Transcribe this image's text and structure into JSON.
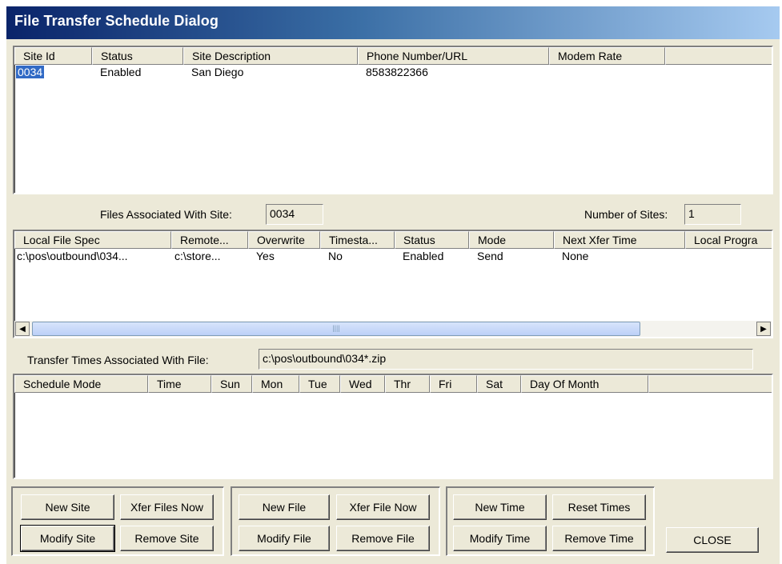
{
  "window": {
    "title": "File Transfer Schedule Dialog"
  },
  "sites": {
    "columns": [
      "Site Id",
      "Status",
      "Site Description",
      "Phone Number/URL",
      "Modem Rate"
    ],
    "rows": [
      {
        "site_id": "0034",
        "status": "Enabled",
        "description": "San Diego",
        "phone": "8583822366",
        "modem_rate": ""
      }
    ]
  },
  "files_assoc": {
    "label": "Files Associated With Site:",
    "value": "0034"
  },
  "num_sites": {
    "label": "Number of Sites:",
    "value": "1"
  },
  "files": {
    "columns": [
      "Local File Spec",
      "Remote...",
      "Overwrite",
      "Timesta...",
      "Status",
      "Mode",
      "Next Xfer Time",
      "Local Progra"
    ],
    "rows": [
      {
        "local": "c:\\pos\\outbound\\034...",
        "remote": "c:\\store...",
        "overwrite": "Yes",
        "timestamp": "No",
        "status": "Enabled",
        "mode": "Send",
        "next": "None",
        "prog": ""
      }
    ],
    "scroll_thumb_icon": "grip-icon"
  },
  "times_assoc": {
    "label": "Transfer Times Associated With File:",
    "value": "c:\\pos\\outbound\\034*.zip"
  },
  "times": {
    "columns": [
      "Schedule Mode",
      "Time",
      "Sun",
      "Mon",
      "Tue",
      "Wed",
      "Thr",
      "Fri",
      "Sat",
      "Day Of Month"
    ],
    "rows": []
  },
  "buttons": {
    "new_site": "New Site",
    "xfer_files_now": "Xfer Files Now",
    "modify_site": "Modify Site",
    "remove_site": "Remove Site",
    "new_file": "New File",
    "xfer_file_now": "Xfer File Now",
    "modify_file": "Modify File",
    "remove_file": "Remove File",
    "new_time": "New Time",
    "reset_times": "Reset Times",
    "modify_time": "Modify Time",
    "remove_time": "Remove Time",
    "close": "CLOSE"
  },
  "colors": {
    "title_start": "#0a246a",
    "title_end": "#a6caf0",
    "selection": "#316ac5",
    "face": "#ece9d8"
  }
}
